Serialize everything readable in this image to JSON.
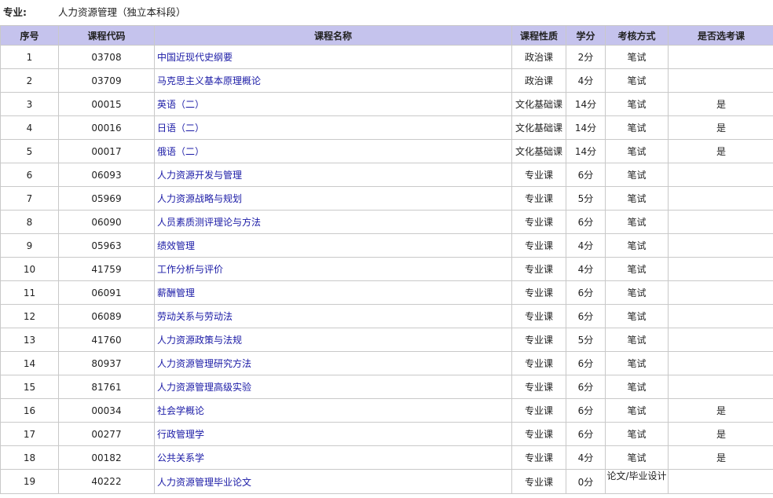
{
  "major": {
    "label": "专业:",
    "value": "人力资源管理（独立本科段）"
  },
  "table": {
    "headers": [
      "序号",
      "课程代码",
      "课程名称",
      "课程性质",
      "学分",
      "考核方式",
      "是否选考课"
    ],
    "rows": [
      {
        "no": "1",
        "code": "03708",
        "name": "中国近现代史纲要",
        "type": "政治课",
        "credit": "2分",
        "exam": "笔试",
        "elective": ""
      },
      {
        "no": "2",
        "code": "03709",
        "name": "马克思主义基本原理概论",
        "type": "政治课",
        "credit": "4分",
        "exam": "笔试",
        "elective": ""
      },
      {
        "no": "3",
        "code": "00015",
        "name": "英语（二）",
        "type": "文化基础课",
        "credit": "14分",
        "exam": "笔试",
        "elective": "是"
      },
      {
        "no": "4",
        "code": "00016",
        "name": "日语（二）",
        "type": "文化基础课",
        "credit": "14分",
        "exam": "笔试",
        "elective": "是"
      },
      {
        "no": "5",
        "code": "00017",
        "name": "俄语（二）",
        "type": "文化基础课",
        "credit": "14分",
        "exam": "笔试",
        "elective": "是"
      },
      {
        "no": "6",
        "code": "06093",
        "name": "人力资源开发与管理",
        "type": "专业课",
        "credit": "6分",
        "exam": "笔试",
        "elective": ""
      },
      {
        "no": "7",
        "code": "05969",
        "name": "人力资源战略与规划",
        "type": "专业课",
        "credit": "5分",
        "exam": "笔试",
        "elective": ""
      },
      {
        "no": "8",
        "code": "06090",
        "name": "人员素质测评理论与方法",
        "type": "专业课",
        "credit": "6分",
        "exam": "笔试",
        "elective": ""
      },
      {
        "no": "9",
        "code": "05963",
        "name": "绩效管理",
        "type": "专业课",
        "credit": "4分",
        "exam": "笔试",
        "elective": ""
      },
      {
        "no": "10",
        "code": "41759",
        "name": "工作分析与评价",
        "type": "专业课",
        "credit": "4分",
        "exam": "笔试",
        "elective": ""
      },
      {
        "no": "11",
        "code": "06091",
        "name": "薪酬管理",
        "type": "专业课",
        "credit": "6分",
        "exam": "笔试",
        "elective": ""
      },
      {
        "no": "12",
        "code": "06089",
        "name": "劳动关系与劳动法",
        "type": "专业课",
        "credit": "6分",
        "exam": "笔试",
        "elective": ""
      },
      {
        "no": "13",
        "code": "41760",
        "name": "人力资源政策与法规",
        "type": "专业课",
        "credit": "5分",
        "exam": "笔试",
        "elective": ""
      },
      {
        "no": "14",
        "code": "80937",
        "name": "人力资源管理研究方法",
        "type": "专业课",
        "credit": "6分",
        "exam": "笔试",
        "elective": ""
      },
      {
        "no": "15",
        "code": "81761",
        "name": "人力资源管理高级实验",
        "type": "专业课",
        "credit": "6分",
        "exam": "笔试",
        "elective": ""
      },
      {
        "no": "16",
        "code": "00034",
        "name": "社会学概论",
        "type": "专业课",
        "credit": "6分",
        "exam": "笔试",
        "elective": "是"
      },
      {
        "no": "17",
        "code": "00277",
        "name": "行政管理学",
        "type": "专业课",
        "credit": "6分",
        "exam": "笔试",
        "elective": "是"
      },
      {
        "no": "18",
        "code": "00182",
        "name": "公共关系学",
        "type": "专业课",
        "credit": "4分",
        "exam": "笔试",
        "elective": "是"
      },
      {
        "no": "19",
        "code": "40222",
        "name": "人力资源管理毕业论文",
        "type": "专业课",
        "credit": "0分",
        "exam": "论文/毕业设计",
        "elective": ""
      }
    ]
  },
  "colors": {
    "header_bg": "#c5c3ed",
    "link": "#1a1aa6",
    "border": "#c9c9c9"
  }
}
